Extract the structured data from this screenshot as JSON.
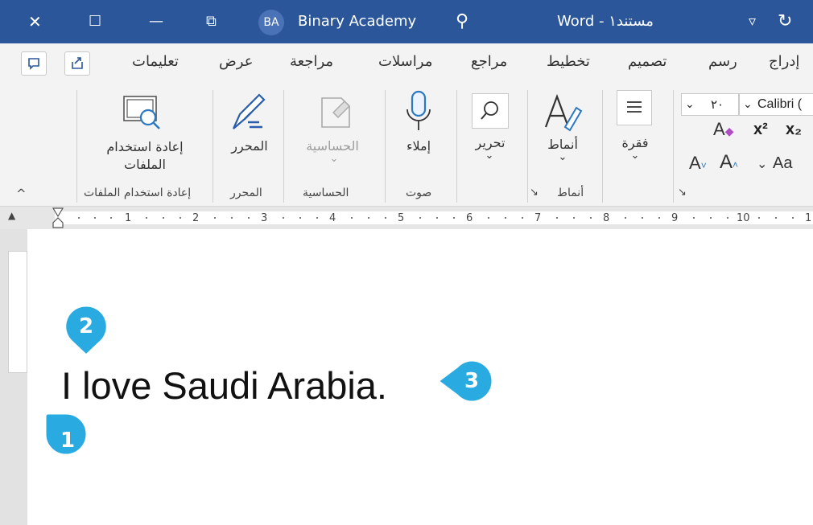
{
  "titlebar": {
    "close_glyph": "✕",
    "maximize_glyph": "☐",
    "minimize_glyph": "—",
    "restore_glyph": "⧉",
    "avatar_initials": "BA",
    "account_name": "Binary Academy",
    "app_title": "Word - مستند١",
    "search_glyph": "⚲",
    "dropdown_glyph": "▿",
    "undo_glyph": "↻",
    "bg_color": "#2b579a"
  },
  "tabs": [
    "تعليمات",
    "عرض",
    "مراجعة",
    "مراسلات",
    "مراجع",
    "تخطيط",
    "تصميم",
    "رسم",
    "إدراج"
  ],
  "ribbon": {
    "reuse_files_label": "إعادة استخدام الملفات",
    "reuse_files_line1": "إعادة استخدام",
    "reuse_files_line2": "الملفات",
    "editor_label": "المحرر",
    "sensitivity_label": "الحساسية",
    "dictate_label": "إملاء",
    "editing_label": "تحرير",
    "styles_label": "أنماط",
    "paragraph_label": "فقرة",
    "groups": {
      "reuse_files": "إعادة استخدام الملفات",
      "editor": "المحرر",
      "sensitivity": "الحساسية",
      "voice": "صوت",
      "styles": "أنماط"
    },
    "font_name": "Calibri (",
    "font_size": "٢٠",
    "font_size_arrow": "⌄",
    "change_case": "Aa",
    "superscript": "x²",
    "subscript": "x₂",
    "collapse_glyph": "^",
    "dropdown_glyph": "⌄"
  },
  "ruler": {
    "numbers": [
      "1",
      "2",
      "3",
      "4",
      "5",
      "6",
      "7",
      "8",
      "9",
      "10",
      "1"
    ]
  },
  "document": {
    "text": "I love Saudi Arabia."
  },
  "callouts": [
    "1",
    "2",
    "3"
  ],
  "callout_color": "#29abe2"
}
